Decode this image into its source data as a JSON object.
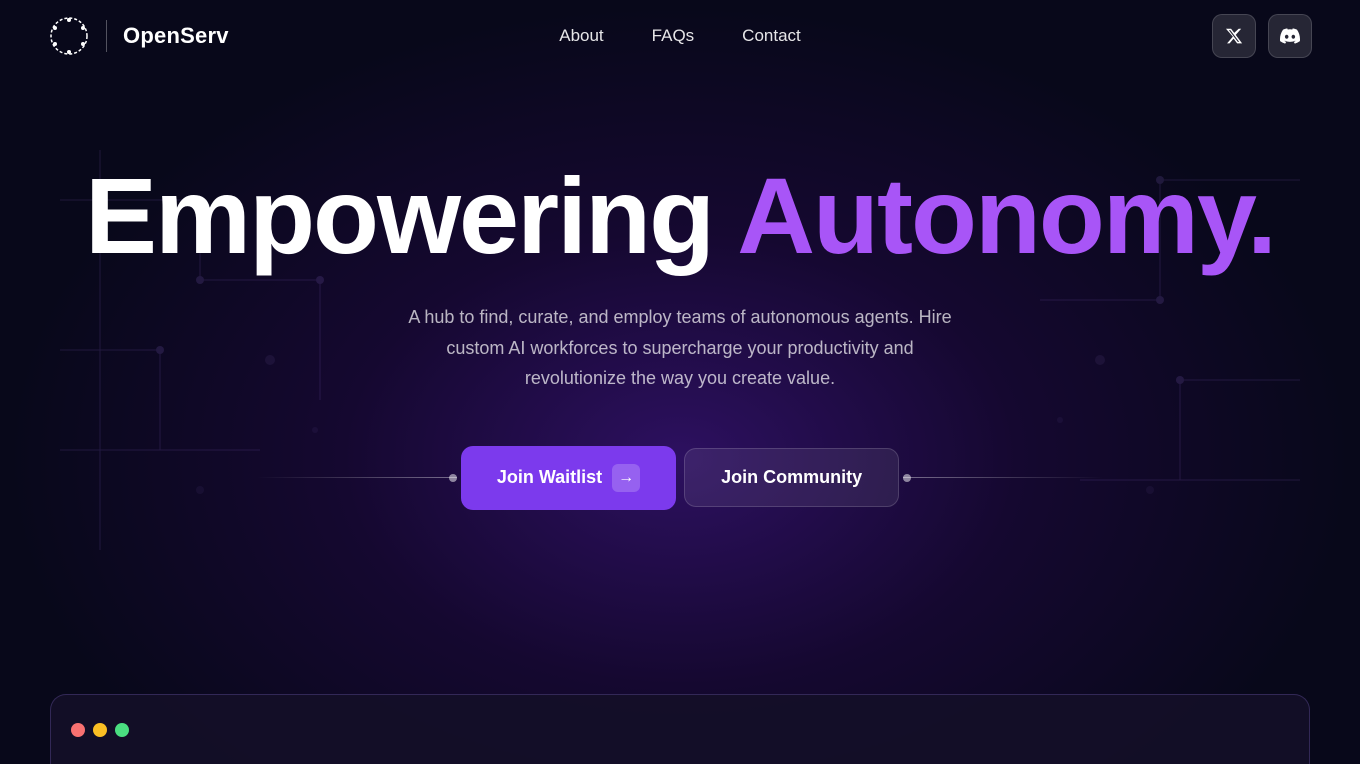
{
  "brand": {
    "name": "OpenServ",
    "logo_aria": "OpenServ logo"
  },
  "nav": {
    "links": [
      {
        "label": "About",
        "id": "about"
      },
      {
        "label": "FAQs",
        "id": "faqs"
      },
      {
        "label": "Contact",
        "id": "contact"
      }
    ],
    "social": [
      {
        "label": "Twitter",
        "icon": "𝕏",
        "id": "twitter"
      },
      {
        "label": "Discord",
        "icon": "▣",
        "id": "discord"
      }
    ]
  },
  "hero": {
    "title_white": "Empowering",
    "title_purple": "Autonomy.",
    "subtitle": "A hub to find, curate, and employ teams of autonomous agents. Hire custom AI workforces to supercharge your productivity and revolutionize the way you create value.",
    "btn_waitlist": "Join Waitlist",
    "btn_community": "Join Community"
  },
  "window_dots": [
    "red",
    "yellow",
    "green"
  ],
  "colors": {
    "accent_purple": "#a855f7",
    "btn_purple": "#7c3aed",
    "bg_dark": "#080818"
  }
}
